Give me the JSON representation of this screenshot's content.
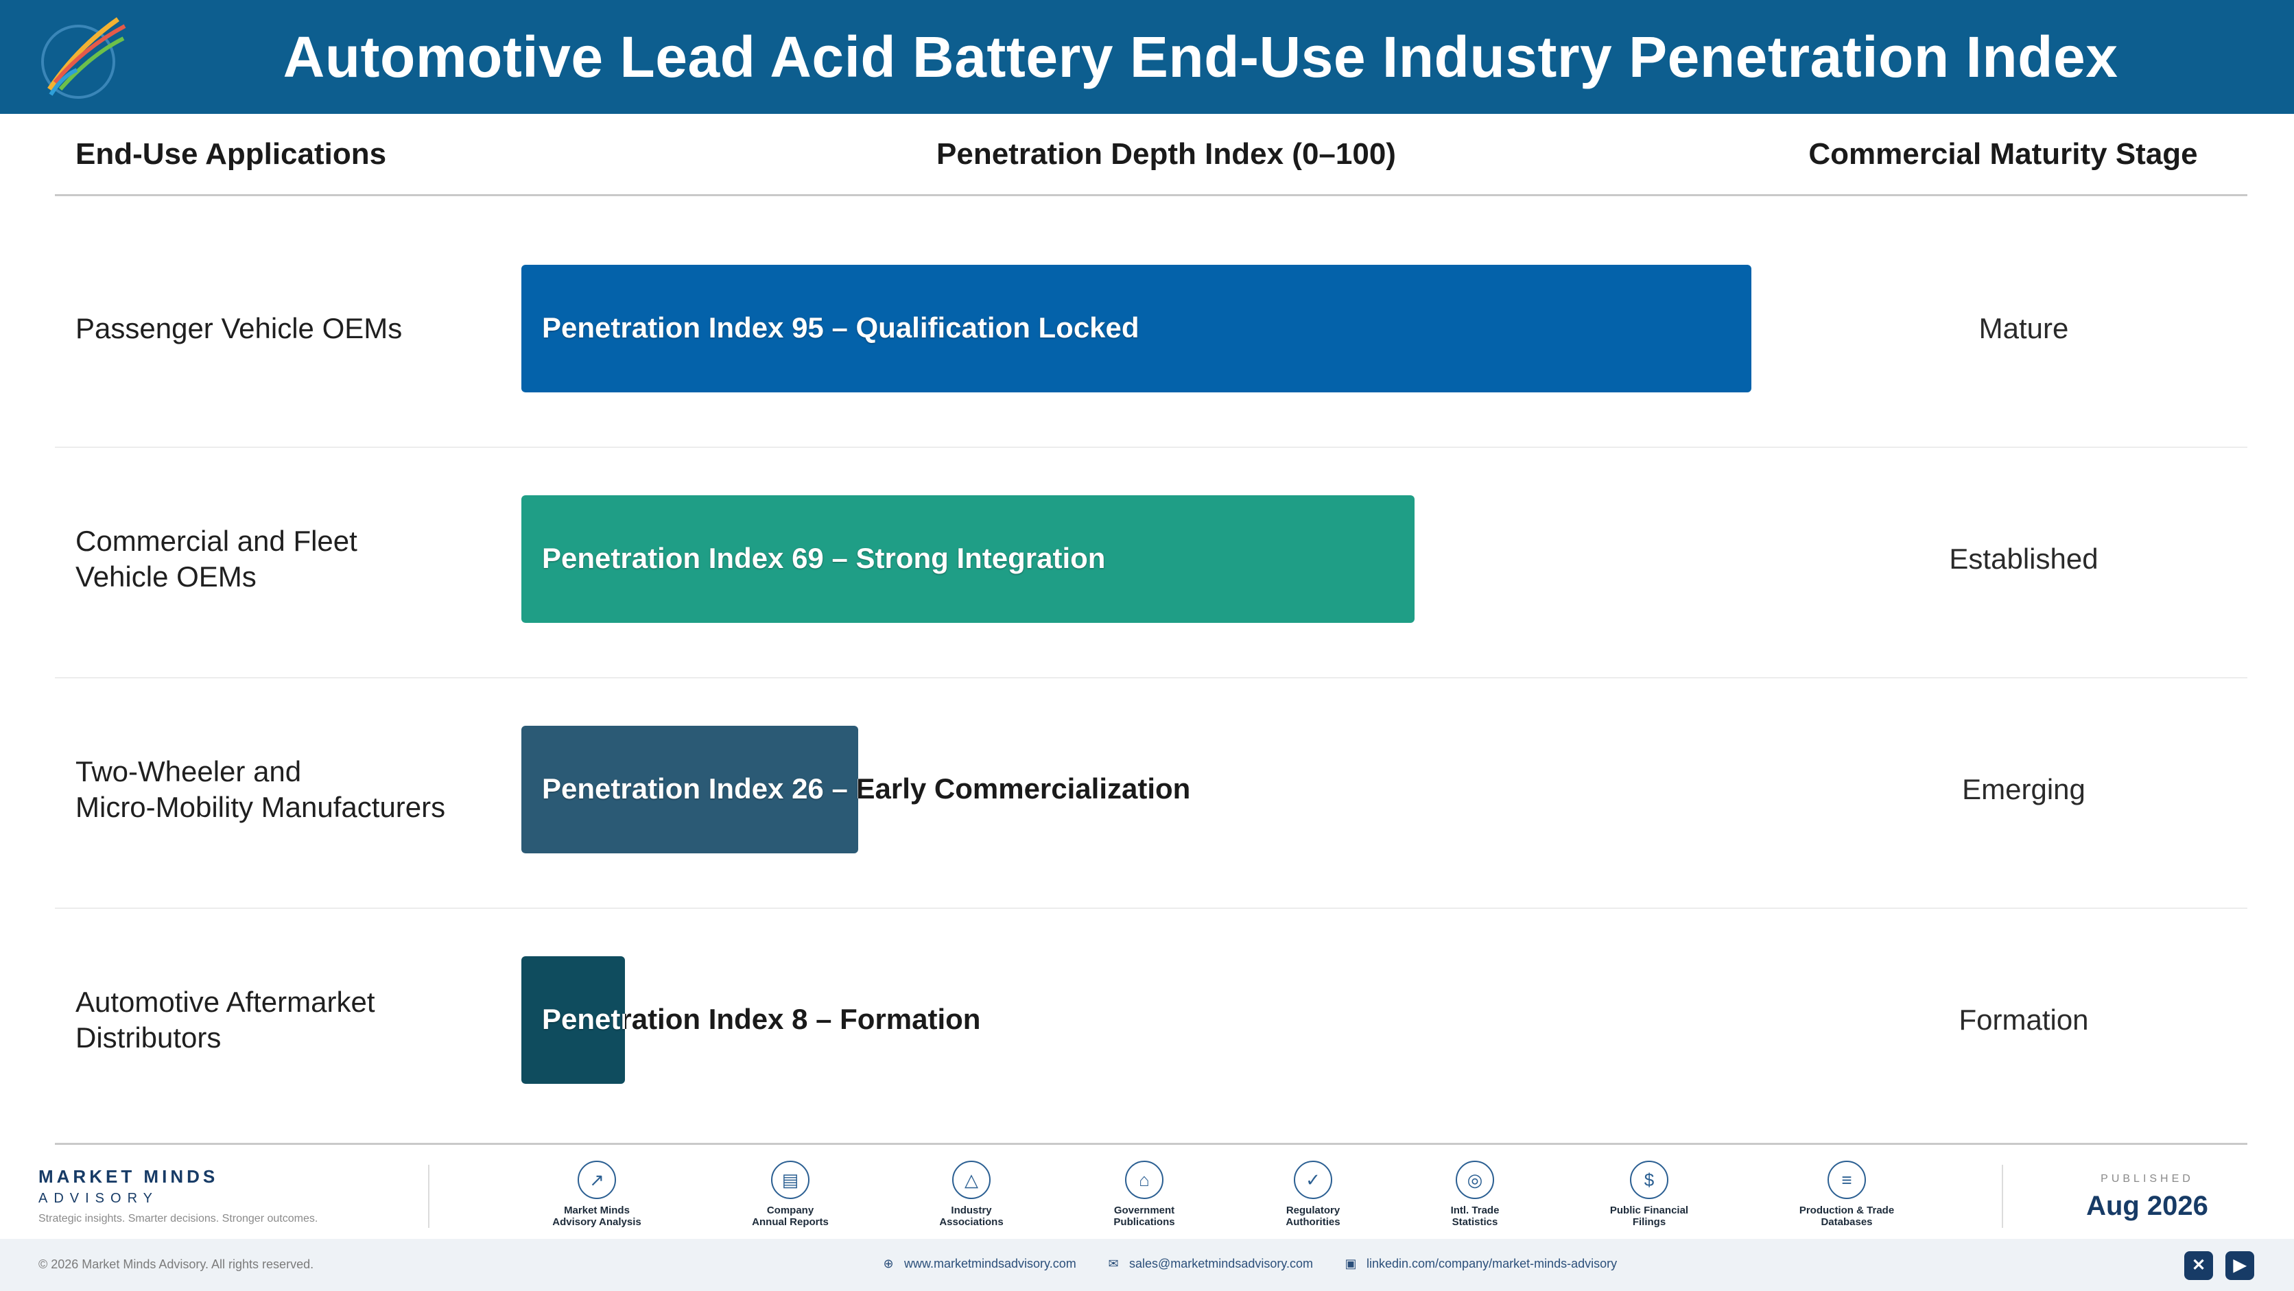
{
  "header": {
    "title": "Automotive Lead Acid Battery End-Use Industry Penetration Index",
    "logo_icon": "market-minds-logo",
    "background": "#0d5e8f"
  },
  "columns": {
    "applications": "End-Use Applications",
    "index": "Penetration Depth Index (0–100)",
    "stage": "Commercial Maturity Stage"
  },
  "chart_data": {
    "type": "bar",
    "orientation": "horizontal",
    "xlim": [
      0,
      100
    ],
    "categories": [
      "Passenger Vehicle OEMs",
      "Commercial and Fleet Vehicle OEMs",
      "Two-Wheeler and Micro-Mobility Manufacturers",
      "Automotive Aftermarket Distributors"
    ],
    "rows": [
      {
        "label_lines": [
          "Passenger Vehicle OEMs"
        ],
        "value": 95,
        "bar_text": "Penetration Index 95 – Qualification Locked",
        "stage": "Mature",
        "color": "#0462aa"
      },
      {
        "label_lines": [
          "Commercial and Fleet",
          "Vehicle OEMs"
        ],
        "value": 69,
        "bar_text": "Penetration Index 69 – Strong Integration",
        "stage": "Established",
        "color": "#1f9e86"
      },
      {
        "label_lines": [
          "Two-Wheeler and",
          "Micro-Mobility Manufacturers"
        ],
        "value": 26,
        "bar_text": "Penetration Index 26 – Early Commercialization",
        "stage": "Emerging",
        "color": "#2b5a75"
      },
      {
        "label_lines": [
          "Automotive Aftermarket",
          "Distributors"
        ],
        "value": 8,
        "bar_text": "Penetration Index 8 – Formation",
        "stage": "Formation",
        "color": "#0f4c5e"
      }
    ]
  },
  "footer": {
    "brand_name": "MARKET MINDS",
    "brand_sub": "ADVISORY",
    "tagline": "Strategic insights. Smarter decisions. Stronger outcomes.",
    "sources": [
      {
        "icon": "chart-line-icon",
        "glyph": "↗",
        "line1": "Market Minds",
        "line2": "Advisory Analysis"
      },
      {
        "icon": "document-icon",
        "glyph": "▤",
        "line1": "Company",
        "line2": "Annual Reports"
      },
      {
        "icon": "network-icon",
        "glyph": "△",
        "line1": "Industry",
        "line2": "Associations"
      },
      {
        "icon": "government-building-icon",
        "glyph": "⌂",
        "line1": "Government",
        "line2": "Publications"
      },
      {
        "icon": "shield-icon",
        "glyph": "✓",
        "line1": "Regulatory",
        "line2": "Authorities"
      },
      {
        "icon": "globe-icon",
        "glyph": "◎",
        "line1": "Intl. Trade",
        "line2": "Statistics"
      },
      {
        "icon": "dollar-coin-icon",
        "glyph": "$",
        "line1": "Public Financial",
        "line2": "Filings"
      },
      {
        "icon": "database-icon",
        "glyph": "≡",
        "line1": "Production & Trade",
        "line2": "Databases"
      }
    ],
    "published_caption": "PUBLISHED",
    "published_date": "Aug 2026",
    "copyright": "© 2026 Market Minds Advisory. All rights reserved.",
    "website": "www.marketmindsadvisory.com",
    "email": "sales@marketmindsadvisory.com",
    "linkedin": "linkedin.com/company/market-minds-advisory",
    "social": [
      {
        "icon": "x-social-icon",
        "glyph": "✕"
      },
      {
        "icon": "youtube-icon",
        "glyph": "▶"
      }
    ]
  }
}
